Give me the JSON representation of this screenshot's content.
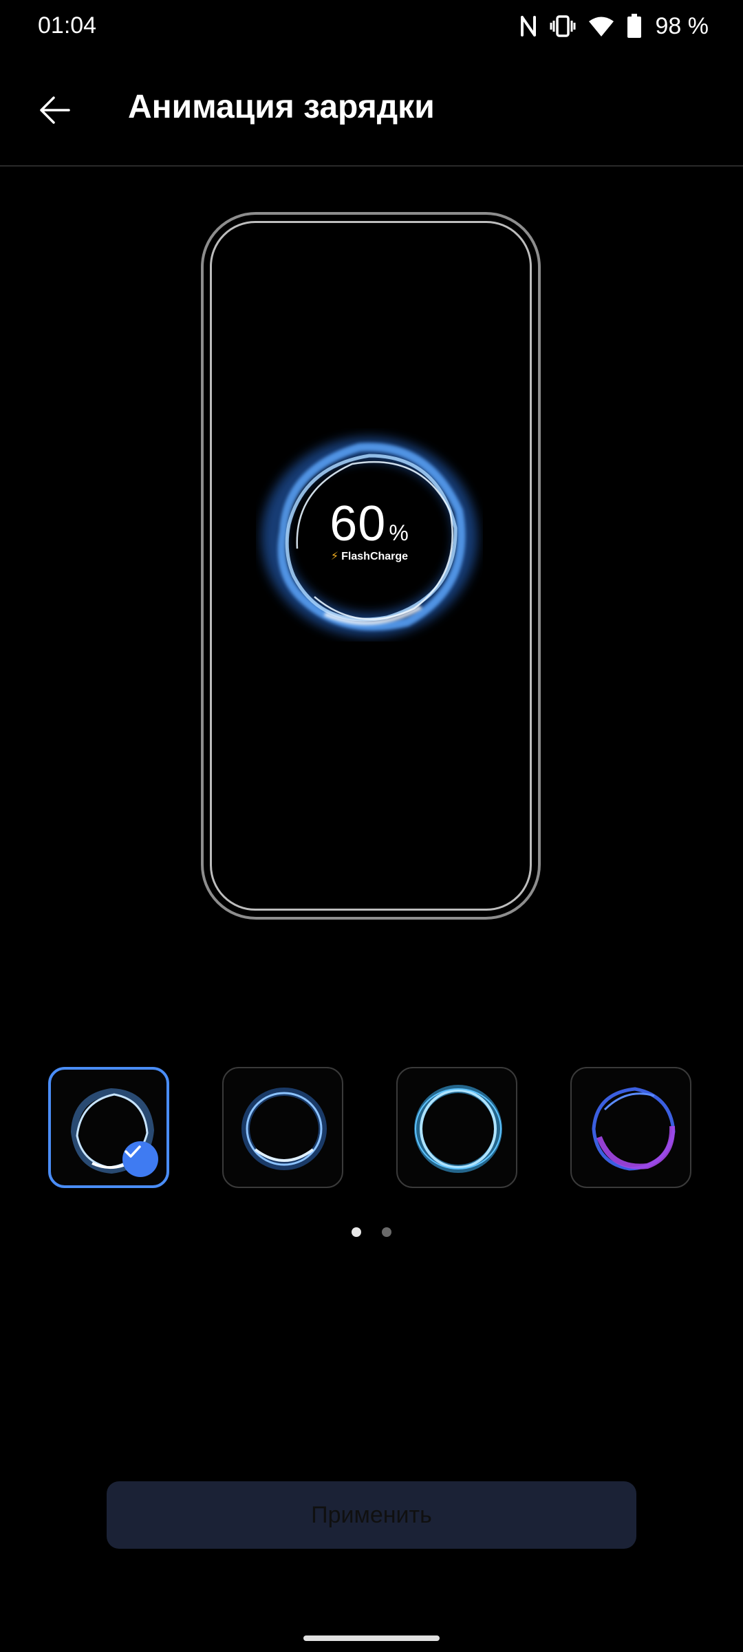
{
  "status_bar": {
    "time": "01:04",
    "battery_text": "98 %",
    "icons": [
      "nfc-icon",
      "vibrate-icon",
      "wifi-icon",
      "battery-icon"
    ]
  },
  "app_bar": {
    "title": "Анимация зарядки",
    "back_icon": "arrow-left-icon"
  },
  "preview": {
    "percent_value": "60",
    "percent_sign": "%",
    "flash_label": "FlashCharge",
    "ring_color": "#7fc0ff"
  },
  "animations": [
    {
      "name": "blue-wave",
      "selected": true
    },
    {
      "name": "blue-glow",
      "selected": false
    },
    {
      "name": "cyan-ring",
      "selected": false
    },
    {
      "name": "purple-wave",
      "selected": false
    }
  ],
  "pager": {
    "pages": 2,
    "active": 1
  },
  "apply_button": {
    "label": "Применить"
  },
  "colors": {
    "accent": "#4a8df6",
    "button_bg": "#1b2236"
  }
}
